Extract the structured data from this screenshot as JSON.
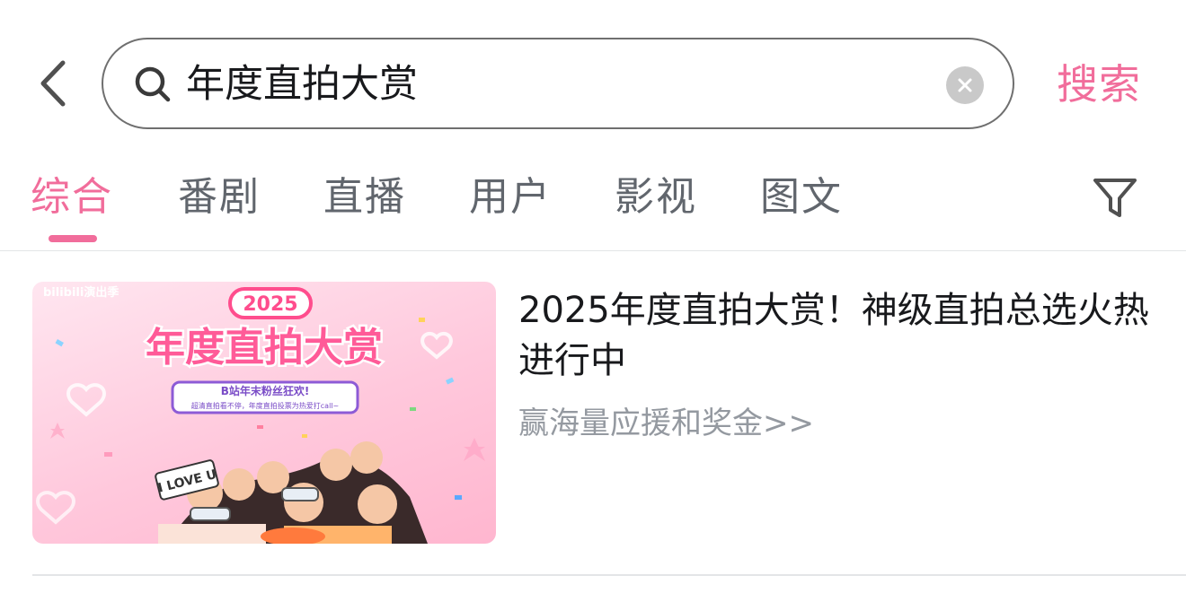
{
  "search": {
    "back_icon": "chevron-left-icon",
    "query": "年度直拍大赏",
    "search_icon": "magnifier-icon",
    "clear_icon": "clear-circle-icon",
    "submit_label": "搜索"
  },
  "tabs": {
    "items": [
      {
        "label": "综合",
        "active": true
      },
      {
        "label": "番剧",
        "active": false
      },
      {
        "label": "直播",
        "active": false
      },
      {
        "label": "用户",
        "active": false
      },
      {
        "label": "影视",
        "active": false
      },
      {
        "label": "图文",
        "active": false
      }
    ],
    "filter_icon": "funnel-filter-icon"
  },
  "result": {
    "thumbnail": {
      "brand_text": "bilibili演出季",
      "year_badge": "2025",
      "headline": "年度直拍大赏",
      "tagline": "B站年末粉丝狂欢!",
      "subline": "超清直拍看不停，年度直拍投票为热爱打call~",
      "sign_text": "I LOVE U"
    },
    "title": "2025年度直拍大赏！神级直拍总选火热进行中",
    "subtitle": "赢海量应援和奖金>>"
  },
  "colors": {
    "accent": "#f16d9b",
    "text_primary": "#18191c",
    "text_secondary": "#9499a0",
    "tab_inactive": "#61666d"
  }
}
